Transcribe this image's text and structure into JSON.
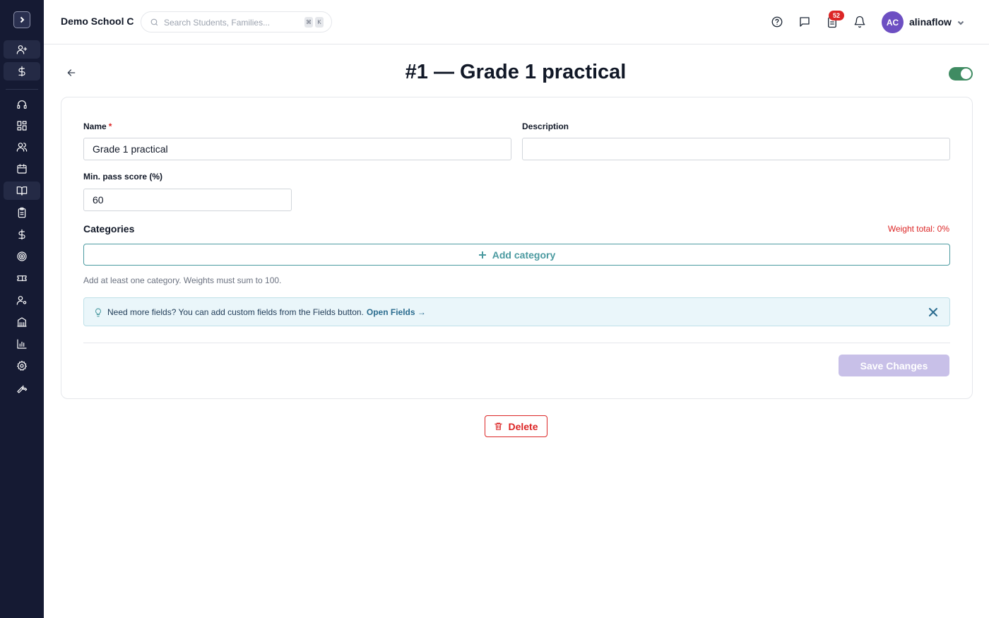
{
  "header": {
    "school_name": "Demo School C",
    "search_placeholder": "Search Students, Families...",
    "search_shortcut": [
      "⌘",
      "K"
    ],
    "tasks_badge": "52",
    "user_initials": "AC",
    "username": "alinaflow"
  },
  "sidebar": {
    "items": [
      {
        "icon": "add-user-icon"
      },
      {
        "icon": "dollar-icon"
      },
      {
        "icon": "headset-icon"
      },
      {
        "icon": "dashboard-icon"
      },
      {
        "icon": "users-icon"
      },
      {
        "icon": "calendar-icon"
      },
      {
        "icon": "book-icon",
        "active": true
      },
      {
        "icon": "clipboard-icon"
      },
      {
        "icon": "dollar-icon"
      },
      {
        "icon": "target-icon"
      },
      {
        "icon": "ticket-icon"
      },
      {
        "icon": "user-settings-icon"
      },
      {
        "icon": "building-icon"
      },
      {
        "icon": "chart-icon"
      },
      {
        "icon": "gear-icon"
      },
      {
        "icon": "wrench-icon"
      }
    ]
  },
  "page": {
    "title": "#1 — Grade 1 practical",
    "active_toggle": true
  },
  "form": {
    "name_label": "Name",
    "name_required": "*",
    "name_value": "Grade 1 practical",
    "description_label": "Description",
    "description_value": "",
    "min_pass_label": "Min. pass score (%)",
    "min_pass_value": "60",
    "categories_title": "Categories",
    "weight_total": "Weight total: 0%",
    "add_category_label": "Add category",
    "hint": "Add at least one category. Weights must sum to 100.",
    "info_text": "Need more fields? You can add custom fields from the Fields button.",
    "info_link": "Open Fields →",
    "save_label": "Save Changes"
  },
  "actions": {
    "delete_label": "Delete"
  },
  "colors": {
    "sidebar_bg": "#151a33",
    "accent_teal": "#4b9aa0",
    "danger": "#dc2626",
    "toggle_on": "#3f8b62",
    "avatar": "#6d4fc2",
    "save_disabled": "#c8c0e8"
  }
}
